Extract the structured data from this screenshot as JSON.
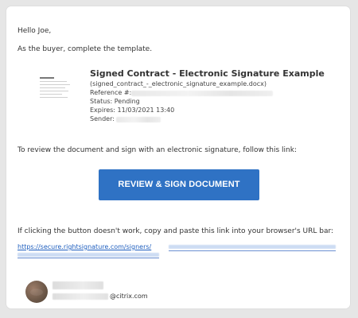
{
  "email": {
    "greeting": "Hello Joe,",
    "intro": "As the buyer, complete the template.",
    "document": {
      "title": "Signed Contract - Electronic Signature Example",
      "filename": "(signed_contract_-_electronic_signature_example.docx)",
      "reference_label": "Reference #: -",
      "status_label": "Status: Pending",
      "expires_label": "Expires: 11/03/2021 13:40",
      "sender_label": "Sender:"
    },
    "instruction": "To review the document and sign with an electronic signature, follow this link:",
    "button_label": "REVIEW & SIGN DOCUMENT",
    "fallback_text": "If clicking the button doesn't work, copy and paste this link into your browser's URL bar:",
    "link_text": "https://secure.rightsignature.com/signers/",
    "signature_domain": "@citrix.com"
  },
  "colors": {
    "button_background": "#2f72c4",
    "link": "#1f5fbf",
    "page_background": "#e6e6e6",
    "card_background": "#ffffff"
  },
  "icons": {
    "document_thumbnail": "document-thumbnail-icon",
    "avatar": "avatar-icon"
  }
}
